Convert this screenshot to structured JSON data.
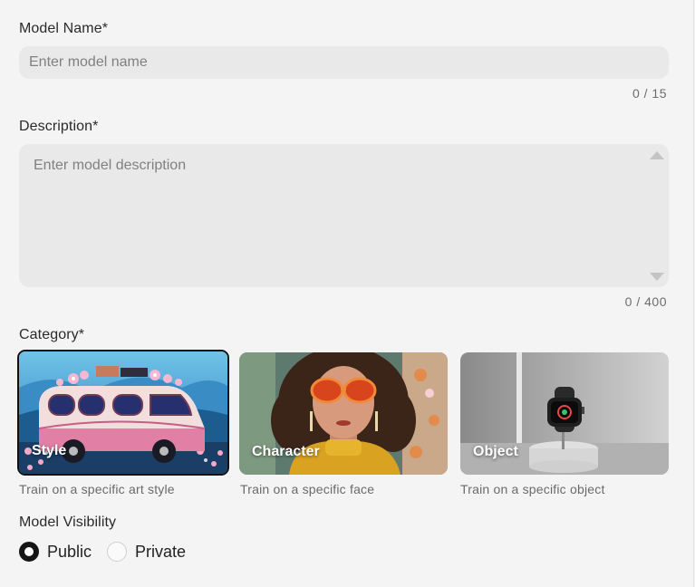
{
  "form": {
    "model_name": {
      "label": "Model Name*",
      "placeholder": "Enter model name",
      "value": "",
      "counter": "0 / 15"
    },
    "description": {
      "label": "Description*",
      "placeholder": "Enter model description",
      "value": "",
      "counter": "0 / 400"
    },
    "category": {
      "label": "Category*",
      "options": [
        {
          "title": "Style",
          "description": "Train on a specific art style",
          "selected": true
        },
        {
          "title": "Character",
          "description": "Train on a specific face",
          "selected": false
        },
        {
          "title": "Object",
          "description": "Train on a specific object",
          "selected": false
        }
      ]
    },
    "visibility": {
      "label": "Model Visibility",
      "options": [
        {
          "label": "Public",
          "selected": true
        },
        {
          "label": "Private",
          "selected": false
        }
      ]
    }
  },
  "colors": {
    "background": "#f4f4f4",
    "input_background": "#e9e9e9",
    "selected_border": "#111111"
  }
}
